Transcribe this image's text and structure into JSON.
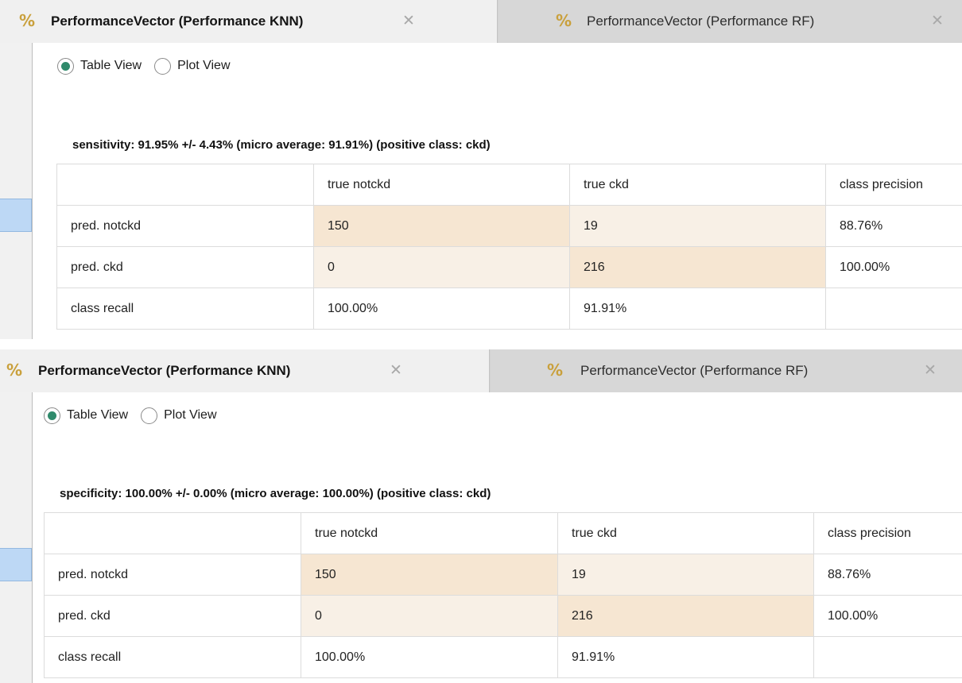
{
  "colors": {
    "tab_icon": "#c9a03c",
    "radio_selected": "#2f8a6b",
    "cell_diagonal": "#f6e6d2",
    "cell_off_diagonal": "#f8f0e6",
    "sidebar_selected": "#bdd8f5"
  },
  "panels": [
    {
      "tabs": [
        {
          "icon": "%",
          "label": "PerformanceVector (Performance KNN)",
          "close": "✕",
          "active": true
        },
        {
          "icon": "%",
          "label": "PerformanceVector (Performance RF)",
          "close": "✕",
          "active": false
        }
      ],
      "view_options": [
        {
          "label": "Table View",
          "selected": true
        },
        {
          "label": "Plot View",
          "selected": false
        }
      ],
      "criterion": "sensitivity: 91.95% +/- 4.43% (micro average: 91.91%) (positive class: ckd)",
      "table": {
        "header": [
          "",
          "true notckd",
          "true ckd",
          "class precision"
        ],
        "rows": [
          [
            "pred. notckd",
            "150",
            "19",
            "88.76%"
          ],
          [
            "pred. ckd",
            "0",
            "216",
            "100.00%"
          ],
          [
            "class recall",
            "100.00%",
            "91.91%",
            ""
          ]
        ]
      }
    },
    {
      "tabs": [
        {
          "icon": "%",
          "label": "PerformanceVector (Performance KNN)",
          "close": "✕",
          "active": true
        },
        {
          "icon": "%",
          "label": "PerformanceVector (Performance RF)",
          "close": "✕",
          "active": false
        }
      ],
      "view_options": [
        {
          "label": "Table View",
          "selected": true
        },
        {
          "label": "Plot View",
          "selected": false
        }
      ],
      "criterion": "specificity: 100.00% +/- 0.00% (micro average: 100.00%) (positive class: ckd)",
      "table": {
        "header": [
          "",
          "true notckd",
          "true ckd",
          "class precision"
        ],
        "rows": [
          [
            "pred. notckd",
            "150",
            "19",
            "88.76%"
          ],
          [
            "pred. ckd",
            "0",
            "216",
            "100.00%"
          ],
          [
            "class recall",
            "100.00%",
            "91.91%",
            ""
          ]
        ]
      }
    }
  ]
}
